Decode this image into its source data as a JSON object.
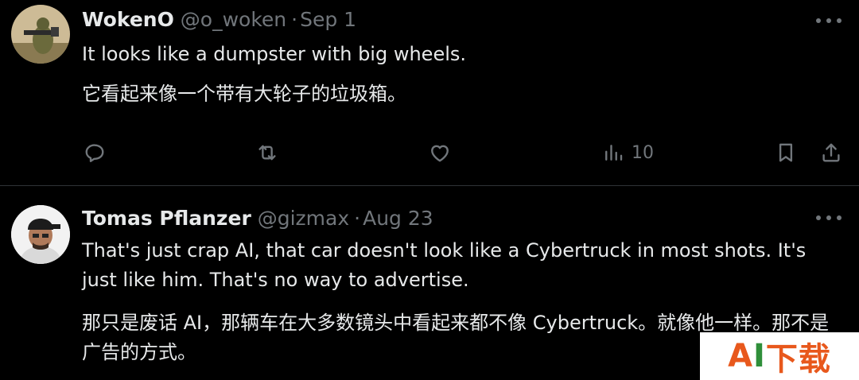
{
  "tweets": [
    {
      "name": "WokenO",
      "handle": "@o_woken",
      "separator": "·",
      "date": "Sep 1",
      "text_en": "It looks like a dumpster with big wheels.",
      "text_zh": "它看起来像一个带有大轮子的垃圾箱。",
      "actions": {
        "reply_icon": "reply-icon",
        "retweet_icon": "retweet-icon",
        "like_icon": "like-icon",
        "views_icon": "views-icon",
        "views_count": "10",
        "bookmark_icon": "bookmark-icon",
        "share_icon": "share-icon"
      }
    },
    {
      "name": "Tomas Pflanzer",
      "handle": "@gizmax",
      "separator": "·",
      "date": "Aug 23",
      "text_en": "That's just crap AI, that car doesn't look like a Cybertruck in most shots. It's just like him. That's no way to advertise.",
      "text_zh": "那只是废话 AI，那辆车在大多数镜头中看起来都不像 Cybertruck。就像他一样。那不是广告的方式。"
    }
  ],
  "watermark": {
    "part1": "A",
    "part2": "I",
    "part3": "下载"
  },
  "colors": {
    "background": "#000000",
    "text": "#e7e9ea",
    "muted": "#71767b",
    "divider": "#2f3336"
  }
}
